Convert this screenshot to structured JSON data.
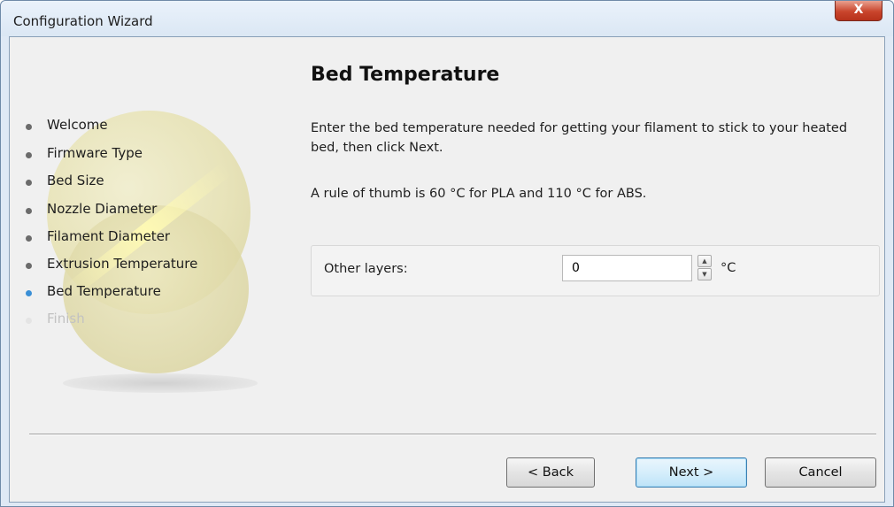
{
  "window": {
    "title": "Configuration Wizard",
    "close_glyph": "X"
  },
  "sidebar": {
    "steps": [
      {
        "label": "Welcome",
        "state": "done"
      },
      {
        "label": "Firmware Type",
        "state": "done"
      },
      {
        "label": "Bed Size",
        "state": "done"
      },
      {
        "label": "Nozzle Diameter",
        "state": "done"
      },
      {
        "label": "Filament Diameter",
        "state": "done"
      },
      {
        "label": "Extrusion Temperature",
        "state": "done"
      },
      {
        "label": "Bed Temperature",
        "state": "current"
      },
      {
        "label": "Finish",
        "state": "pending"
      }
    ]
  },
  "page": {
    "heading": "Bed Temperature",
    "description": "Enter the bed temperature needed for getting your filament to stick to your heated bed, then click Next.",
    "note": "A rule of thumb is 60 °C for PLA and 110 °C for ABS."
  },
  "form": {
    "other_layers_label": "Other layers:",
    "other_layers_value": "0",
    "unit": "°C"
  },
  "buttons": {
    "back": "< Back",
    "next": "Next >",
    "cancel": "Cancel"
  },
  "colors": {
    "current_step_dot": "#3a8fd6",
    "default_button_border": "#3c7fb1",
    "close_button": "#c9452c"
  }
}
